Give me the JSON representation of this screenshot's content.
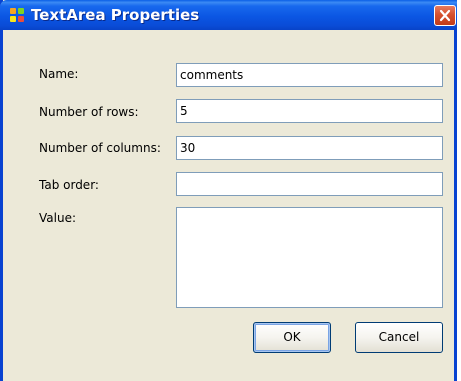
{
  "window": {
    "title": "TextArea Properties",
    "icon": "app-icon",
    "close_icon": "close-icon",
    "titlebar_color": "#0b56e3",
    "background_color": "#ece9d8"
  },
  "form": {
    "name": {
      "label": "Name:",
      "value": "comments"
    },
    "rows": {
      "label": "Number of rows:",
      "value": "5"
    },
    "columns": {
      "label": "Number of columns:",
      "value": "30"
    },
    "tab_order": {
      "label": "Tab order:",
      "value": ""
    },
    "value": {
      "label": "Value:",
      "value": ""
    }
  },
  "buttons": {
    "ok_label": "OK",
    "cancel_label": "Cancel"
  }
}
